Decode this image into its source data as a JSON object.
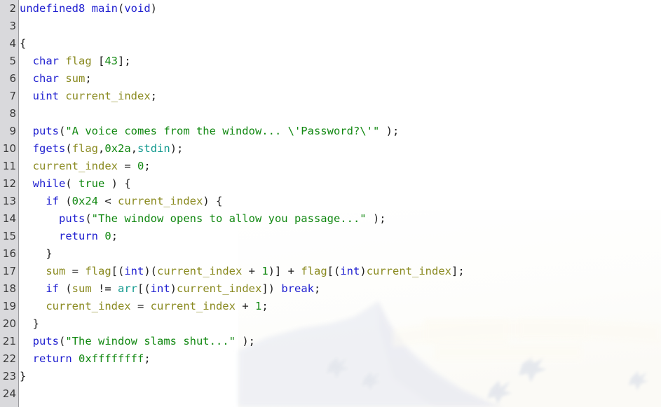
{
  "view": {
    "name": "decompiler-code-view",
    "language": "c",
    "first_line": 2,
    "last_line": 24,
    "line_height_px": 25,
    "colors": {
      "background": "#ffffff",
      "gutter_background": "#d9d9dc",
      "gutter_border": "#9a9a9e",
      "gutter_text": "#3a3a3a",
      "keyword": "#2020d0",
      "variable": "#8a8a20",
      "global": "#11998e",
      "constant": "#118811",
      "string": "#118811",
      "punctuation": "#202020",
      "watermark": "#eceef3"
    }
  },
  "line_numbers": [
    "2",
    "3",
    "4",
    "5",
    "6",
    "7",
    "8",
    "9",
    "10",
    "11",
    "12",
    "13",
    "14",
    "15",
    "16",
    "17",
    "18",
    "19",
    "20",
    "21",
    "22",
    "23",
    "24"
  ],
  "code_lines": [
    {
      "number": "2",
      "text": "undefined8 main(void)",
      "tokens": [
        {
          "t": "undefined8",
          "c": "kw"
        },
        {
          "t": " ",
          "c": "op"
        },
        {
          "t": "main",
          "c": "fn"
        },
        {
          "t": "(",
          "c": "op"
        },
        {
          "t": "void",
          "c": "kw"
        },
        {
          "t": ")",
          "c": "op"
        }
      ]
    },
    {
      "number": "3",
      "text": "",
      "tokens": []
    },
    {
      "number": "4",
      "text": "{",
      "tokens": [
        {
          "t": "{",
          "c": "op"
        }
      ]
    },
    {
      "number": "5",
      "text": "  char flag [43];",
      "tokens": [
        {
          "t": "  ",
          "c": "op"
        },
        {
          "t": "char",
          "c": "kw"
        },
        {
          "t": " ",
          "c": "op"
        },
        {
          "t": "flag",
          "c": "var"
        },
        {
          "t": " [",
          "c": "op"
        },
        {
          "t": "43",
          "c": "num"
        },
        {
          "t": "];",
          "c": "op"
        }
      ]
    },
    {
      "number": "6",
      "text": "  char sum;",
      "tokens": [
        {
          "t": "  ",
          "c": "op"
        },
        {
          "t": "char",
          "c": "kw"
        },
        {
          "t": " ",
          "c": "op"
        },
        {
          "t": "sum",
          "c": "var"
        },
        {
          "t": ";",
          "c": "op"
        }
      ]
    },
    {
      "number": "7",
      "text": "  uint current_index;",
      "tokens": [
        {
          "t": "  ",
          "c": "op"
        },
        {
          "t": "uint",
          "c": "kw"
        },
        {
          "t": " ",
          "c": "op"
        },
        {
          "t": "current_index",
          "c": "var"
        },
        {
          "t": ";",
          "c": "op"
        }
      ]
    },
    {
      "number": "8",
      "text": "  ",
      "tokens": []
    },
    {
      "number": "9",
      "text": "  puts(\"A voice comes from the window... \\'Password?\\'\" );",
      "tokens": [
        {
          "t": "  ",
          "c": "op"
        },
        {
          "t": "puts",
          "c": "fn"
        },
        {
          "t": "(",
          "c": "op"
        },
        {
          "t": "\"A voice comes from the window... \\'Password?\\'\"",
          "c": "str"
        },
        {
          "t": " );",
          "c": "op"
        }
      ]
    },
    {
      "number": "10",
      "text": "  fgets(flag,0x2a,stdin);",
      "tokens": [
        {
          "t": "  ",
          "c": "op"
        },
        {
          "t": "fgets",
          "c": "fn"
        },
        {
          "t": "(",
          "c": "op"
        },
        {
          "t": "flag",
          "c": "var"
        },
        {
          "t": ",",
          "c": "op"
        },
        {
          "t": "0x2a",
          "c": "num"
        },
        {
          "t": ",",
          "c": "op"
        },
        {
          "t": "stdin",
          "c": "glb"
        },
        {
          "t": ");",
          "c": "op"
        }
      ]
    },
    {
      "number": "11",
      "text": "  current_index = 0;",
      "tokens": [
        {
          "t": "  ",
          "c": "op"
        },
        {
          "t": "current_index",
          "c": "var"
        },
        {
          "t": " = ",
          "c": "op"
        },
        {
          "t": "0",
          "c": "num"
        },
        {
          "t": ";",
          "c": "op"
        }
      ]
    },
    {
      "number": "12",
      "text": "  while( true ) {",
      "tokens": [
        {
          "t": "  ",
          "c": "op"
        },
        {
          "t": "while",
          "c": "kw"
        },
        {
          "t": "( ",
          "c": "op"
        },
        {
          "t": "true",
          "c": "num"
        },
        {
          "t": " ) {",
          "c": "op"
        }
      ]
    },
    {
      "number": "13",
      "text": "    if (0x24 < current_index) {",
      "tokens": [
        {
          "t": "    ",
          "c": "op"
        },
        {
          "t": "if",
          "c": "kw"
        },
        {
          "t": " (",
          "c": "op"
        },
        {
          "t": "0x24",
          "c": "num"
        },
        {
          "t": " < ",
          "c": "op"
        },
        {
          "t": "current_index",
          "c": "var"
        },
        {
          "t": ") {",
          "c": "op"
        }
      ]
    },
    {
      "number": "14",
      "text": "      puts(\"The window opens to allow you passage...\" );",
      "tokens": [
        {
          "t": "      ",
          "c": "op"
        },
        {
          "t": "puts",
          "c": "fn"
        },
        {
          "t": "(",
          "c": "op"
        },
        {
          "t": "\"The window opens to allow you passage...\"",
          "c": "str"
        },
        {
          "t": " );",
          "c": "op"
        }
      ]
    },
    {
      "number": "15",
      "text": "      return 0;",
      "tokens": [
        {
          "t": "      ",
          "c": "op"
        },
        {
          "t": "return",
          "c": "kw"
        },
        {
          "t": " ",
          "c": "op"
        },
        {
          "t": "0",
          "c": "num"
        },
        {
          "t": ";",
          "c": "op"
        }
      ]
    },
    {
      "number": "16",
      "text": "    }",
      "tokens": [
        {
          "t": "    }",
          "c": "op"
        }
      ]
    },
    {
      "number": "17",
      "text": "    sum = flag[(int)(current_index + 1)] + flag[(int)current_index];",
      "tokens": [
        {
          "t": "    ",
          "c": "op"
        },
        {
          "t": "sum",
          "c": "var"
        },
        {
          "t": " = ",
          "c": "op"
        },
        {
          "t": "flag",
          "c": "var"
        },
        {
          "t": "[(",
          "c": "op"
        },
        {
          "t": "int",
          "c": "kw"
        },
        {
          "t": ")(",
          "c": "op"
        },
        {
          "t": "current_index",
          "c": "var"
        },
        {
          "t": " + ",
          "c": "op"
        },
        {
          "t": "1",
          "c": "num"
        },
        {
          "t": ")] + ",
          "c": "op"
        },
        {
          "t": "flag",
          "c": "var"
        },
        {
          "t": "[(",
          "c": "op"
        },
        {
          "t": "int",
          "c": "kw"
        },
        {
          "t": ")",
          "c": "op"
        },
        {
          "t": "current_index",
          "c": "var"
        },
        {
          "t": "];",
          "c": "op"
        }
      ]
    },
    {
      "number": "18",
      "text": "    if (sum != arr[(int)current_index]) break;",
      "tokens": [
        {
          "t": "    ",
          "c": "op"
        },
        {
          "t": "if",
          "c": "kw"
        },
        {
          "t": " (",
          "c": "op"
        },
        {
          "t": "sum",
          "c": "var"
        },
        {
          "t": " != ",
          "c": "op"
        },
        {
          "t": "arr",
          "c": "glb"
        },
        {
          "t": "[(",
          "c": "op"
        },
        {
          "t": "int",
          "c": "kw"
        },
        {
          "t": ")",
          "c": "op"
        },
        {
          "t": "current_index",
          "c": "var"
        },
        {
          "t": "]) ",
          "c": "op"
        },
        {
          "t": "break",
          "c": "kw"
        },
        {
          "t": ";",
          "c": "op"
        }
      ]
    },
    {
      "number": "19",
      "text": "    current_index = current_index + 1;",
      "tokens": [
        {
          "t": "    ",
          "c": "op"
        },
        {
          "t": "current_index",
          "c": "var"
        },
        {
          "t": " = ",
          "c": "op"
        },
        {
          "t": "current_index",
          "c": "var"
        },
        {
          "t": " + ",
          "c": "op"
        },
        {
          "t": "1",
          "c": "num"
        },
        {
          "t": ";",
          "c": "op"
        }
      ]
    },
    {
      "number": "20",
      "text": "  }",
      "tokens": [
        {
          "t": "  }",
          "c": "op"
        }
      ]
    },
    {
      "number": "21",
      "text": "  puts(\"The window slams shut...\" );",
      "tokens": [
        {
          "t": "  ",
          "c": "op"
        },
        {
          "t": "puts",
          "c": "fn"
        },
        {
          "t": "(",
          "c": "op"
        },
        {
          "t": "\"The window slams shut...\"",
          "c": "str"
        },
        {
          "t": " );",
          "c": "op"
        }
      ]
    },
    {
      "number": "22",
      "text": "  return 0xffffffff;",
      "tokens": [
        {
          "t": "  ",
          "c": "op"
        },
        {
          "t": "return",
          "c": "kw"
        },
        {
          "t": " ",
          "c": "op"
        },
        {
          "t": "0xffffffff",
          "c": "num"
        },
        {
          "t": ";",
          "c": "op"
        }
      ]
    },
    {
      "number": "23",
      "text": "}",
      "tokens": [
        {
          "t": "}",
          "c": "op"
        }
      ]
    },
    {
      "number": "24",
      "text": "",
      "tokens": []
    }
  ]
}
